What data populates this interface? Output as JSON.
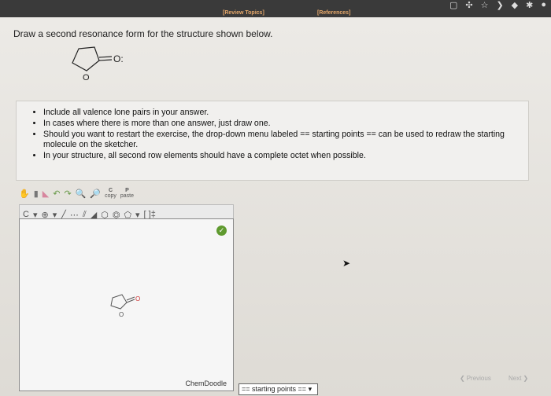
{
  "header": {
    "review_topics": "[Review Topics]",
    "references": "[References]",
    "window_icons": [
      "square-icon",
      "puzzle-icon",
      "star-icon",
      "chevron-icon",
      "shield-icon",
      "bug-icon",
      "star-icon",
      "avatar-icon"
    ]
  },
  "question": {
    "prompt": "Draw a second resonance form for the structure shown below.",
    "carbonyl_o": "O:",
    "ring_o": "O"
  },
  "instructions": {
    "items": [
      "Include all valence lone pairs in your answer.",
      "In cases where there is more than one answer, just draw one.",
      "Should you want to restart the exercise, the drop-down menu labeled == starting points == can be used to redraw the starting molecule on the sketcher.",
      "In your structure, all second row elements should have a complete octet when possible."
    ]
  },
  "sketcher": {
    "toolbar1": [
      "hand-icon",
      "delete-icon",
      "eraser-icon",
      "undo-icon",
      "redo-icon",
      "zoom-in-icon",
      "zoom-out-icon",
      "copy-icon",
      "paste-icon"
    ],
    "copy_letter": "C",
    "copy_label": "copy",
    "paste_letter": "P",
    "paste_label": "paste",
    "element_label": "C",
    "charge_label": "⊕",
    "bracket_label": "[ ]‡",
    "watermark": "ChemDoodle",
    "canvas_o1": "O",
    "canvas_o2": "O"
  },
  "controls": {
    "starting_points": "== starting points ==",
    "previous": "Previous",
    "next": "Next"
  }
}
